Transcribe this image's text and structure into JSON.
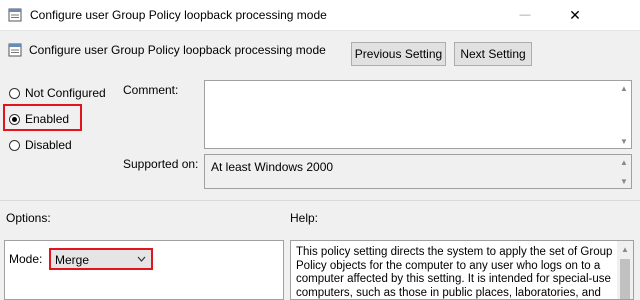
{
  "window": {
    "title": "Configure user Group Policy loopback processing mode",
    "minimize_glyph": "—",
    "close_glyph": "✕"
  },
  "header": {
    "title": "Configure user Group Policy loopback processing mode",
    "previous_label": "Previous Setting",
    "next_label": "Next Setting"
  },
  "state": {
    "options": [
      {
        "label": "Not Configured",
        "selected": false
      },
      {
        "label": "Enabled",
        "selected": true
      },
      {
        "label": "Disabled",
        "selected": false
      }
    ]
  },
  "comment": {
    "label": "Comment:",
    "value": ""
  },
  "supported": {
    "label": "Supported on:",
    "value": "At least Windows 2000"
  },
  "options_section": {
    "label": "Options:",
    "mode_label": "Mode:",
    "mode_value": "Merge"
  },
  "help_section": {
    "label": "Help:",
    "text": "This policy setting directs the system to apply the set of Group Policy objects for the computer to any user who logs on to a computer affected by this setting. It is intended for special-use computers, such as those in public places, laboratories, and"
  },
  "colors": {
    "highlight": "#e0161c",
    "window_bg": "#f0f0f0"
  },
  "icons": [
    "policy-icon",
    "minimize-icon",
    "close-icon",
    "chevron-down-icon"
  ]
}
